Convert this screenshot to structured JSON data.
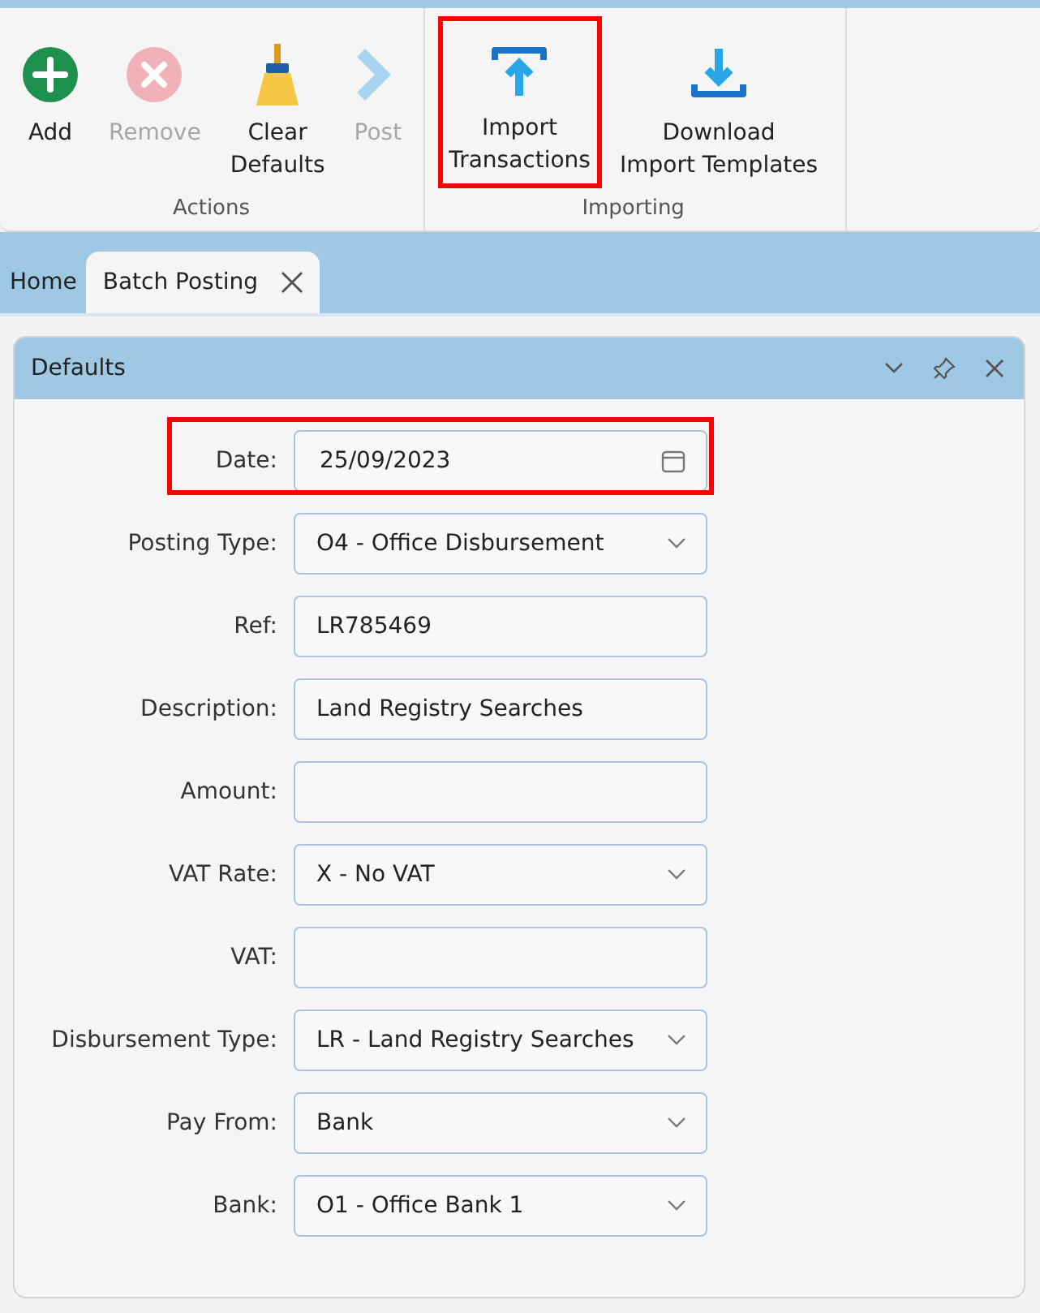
{
  "ribbon": {
    "groups": [
      {
        "label": "Actions",
        "buttons": [
          {
            "label": "Add",
            "disabled": false,
            "highlighted": false
          },
          {
            "label": "Remove",
            "disabled": true,
            "highlighted": false
          },
          {
            "label": "Clear Defaults",
            "disabled": false,
            "highlighted": false
          },
          {
            "label": "Post",
            "disabled": true,
            "highlighted": false
          }
        ]
      },
      {
        "label": "Importing",
        "buttons": [
          {
            "label": "Import Transactions",
            "disabled": false,
            "highlighted": true
          },
          {
            "label": "Download Import Templates",
            "disabled": false,
            "highlighted": false
          }
        ]
      }
    ]
  },
  "tabs": [
    {
      "label": "Home",
      "selected": false,
      "closable": false
    },
    {
      "label": "Batch Posting",
      "selected": true,
      "closable": true
    }
  ],
  "panel": {
    "title": "Defaults",
    "fields": [
      {
        "label": "Date:",
        "kind": "date",
        "value": "25/09/2023",
        "highlighted": true
      },
      {
        "label": "Posting Type:",
        "kind": "select",
        "value": "O4 - Office Disbursement",
        "highlighted": false
      },
      {
        "label": "Ref:",
        "kind": "text",
        "value": "LR785469",
        "highlighted": false
      },
      {
        "label": "Description:",
        "kind": "text",
        "value": "Land Registry Searches",
        "highlighted": false
      },
      {
        "label": "Amount:",
        "kind": "text",
        "highlighted": false
      },
      {
        "label": "VAT Rate:",
        "kind": "select",
        "value": "X - No VAT",
        "highlighted": false
      },
      {
        "label": "VAT:",
        "kind": "text",
        "highlighted": false
      },
      {
        "label": "Disbursement Type:",
        "kind": "select",
        "value": "LR - Land Registry Searches",
        "highlighted": false
      },
      {
        "label": "Pay From:",
        "kind": "select",
        "value": "Bank",
        "highlighted": false
      },
      {
        "label": "Bank:",
        "kind": "select",
        "value": "O1 - Office Bank 1",
        "highlighted": false
      }
    ]
  }
}
